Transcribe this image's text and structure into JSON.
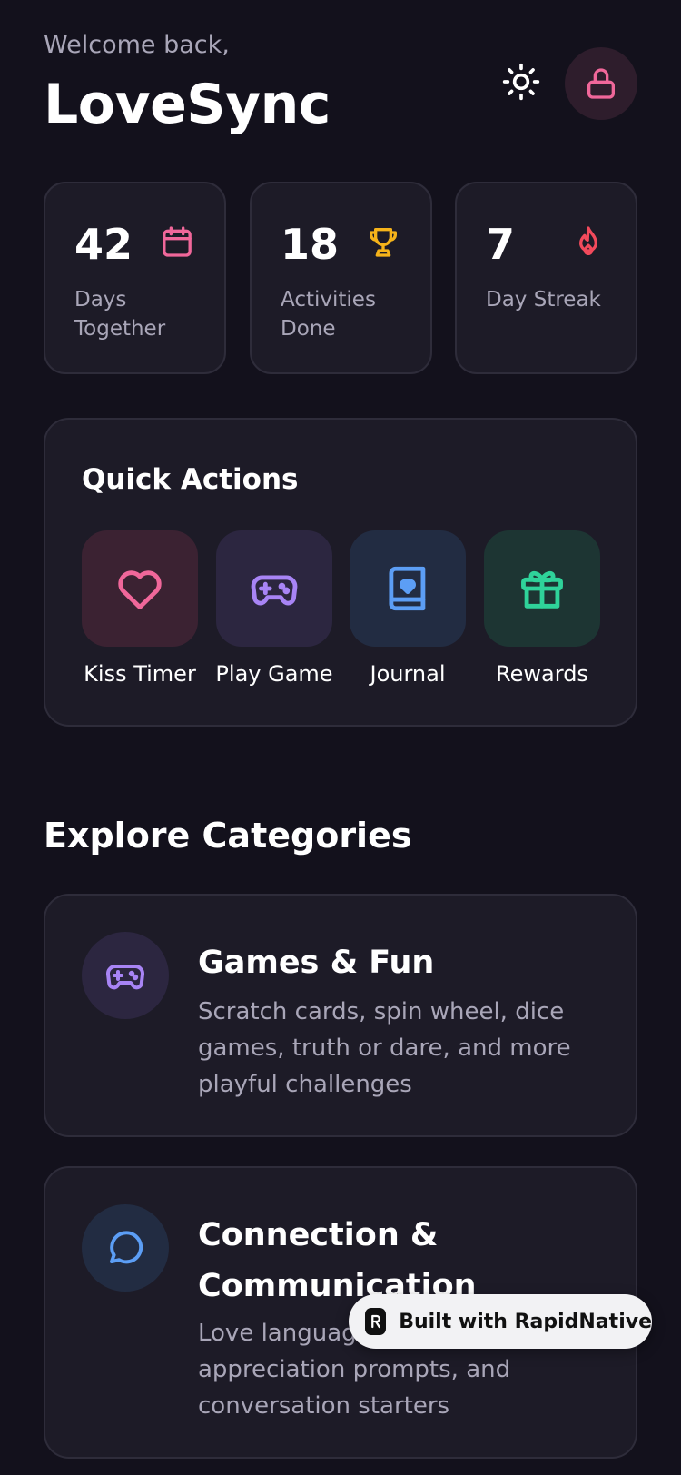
{
  "header": {
    "welcome": "Welcome back,",
    "title": "LoveSync",
    "theme_icon": "sun-icon",
    "lock_icon": "lock-icon"
  },
  "stats": [
    {
      "value": "42",
      "label": "Days Together",
      "icon": "calendar-icon",
      "color": "#f0679a"
    },
    {
      "value": "18",
      "label": "Activities Done",
      "icon": "trophy-icon",
      "color": "#f5b31a"
    },
    {
      "value": "7",
      "label": "Day Streak",
      "icon": "flame-icon",
      "color": "#f24a5c"
    }
  ],
  "quick_actions": {
    "title": "Quick Actions",
    "items": [
      {
        "label": "Kiss Timer",
        "icon": "heart-icon",
        "color": "#f0679a",
        "bg": "#3b2232"
      },
      {
        "label": "Play Game",
        "icon": "gamepad-icon",
        "color": "#a884f5",
        "bg": "#2c2640"
      },
      {
        "label": "Journal",
        "icon": "journal-icon",
        "color": "#5c9ef5",
        "bg": "#222c42"
      },
      {
        "label": "Rewards",
        "icon": "gift-icon",
        "color": "#2fd39a",
        "bg": "#1d3533"
      }
    ]
  },
  "explore": {
    "title": "Explore Categories",
    "categories": [
      {
        "title": "Games & Fun",
        "description": "Scratch cards, spin wheel, dice games, truth or dare, and more playful challenges",
        "icon": "gamepad-icon",
        "color": "#a884f5"
      },
      {
        "title": "Connection & Communication",
        "description": "Love language questions, appreciation prompts, and conversation starters",
        "icon": "chat-bubble-icon",
        "color": "#5c9ef5"
      }
    ]
  },
  "badge": {
    "text": "Built with RapidNative"
  }
}
